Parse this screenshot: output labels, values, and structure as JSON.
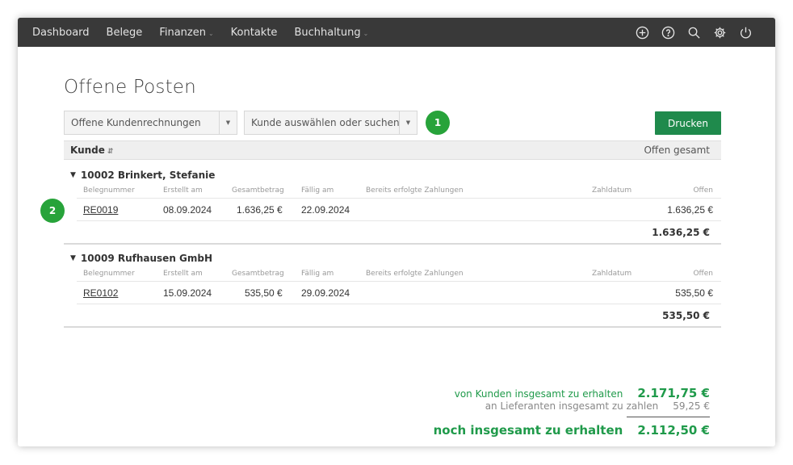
{
  "nav": {
    "items": [
      {
        "label": "Dashboard",
        "dropdown": false
      },
      {
        "label": "Belege",
        "dropdown": false
      },
      {
        "label": "Finanzen",
        "dropdown": true
      },
      {
        "label": "Kontakte",
        "dropdown": false
      },
      {
        "label": "Buchhaltung",
        "dropdown": true
      }
    ],
    "icons": [
      "plus-circle-icon",
      "help-circle-icon",
      "search-icon",
      "gear-icon",
      "power-icon"
    ]
  },
  "page": {
    "title": "Offene Posten",
    "filter_type": "Offene Kundenrechnungen",
    "customer_placeholder": "Kunde auswählen oder suchen",
    "badge_1": "1",
    "badge_2": "2",
    "print_label": "Drucken"
  },
  "table": {
    "col_customer": "Kunde",
    "col_open_total": "Offen gesamt",
    "sub_headers": {
      "belegnummer": "Belegnummer",
      "erstellt": "Erstellt am",
      "gesamtbetrag": "Gesamtbetrag",
      "faellig": "Fällig am",
      "zahlungen": "Bereits erfolgte Zahlungen",
      "zahldatum": "Zahldatum",
      "offen": "Offen"
    },
    "groups": [
      {
        "name": "10002 Brinkert, Stefanie",
        "rows": [
          {
            "beleg": "RE0019",
            "erstellt": "08.09.2024",
            "gesamt": "1.636,25 €",
            "faellig": "22.09.2024",
            "offen": "1.636,25 €"
          }
        ],
        "total": "1.636,25 €"
      },
      {
        "name": "10009 Rufhausen GmbH",
        "rows": [
          {
            "beleg": "RE0102",
            "erstellt": "15.09.2024",
            "gesamt": "535,50 €",
            "faellig": "29.09.2024",
            "offen": "535,50 €"
          }
        ],
        "total": "535,50 €"
      }
    ]
  },
  "summary": {
    "receive_label": "von Kunden insgesamt zu erhalten",
    "receive_value": "2.171,75 €",
    "pay_label": "an Lieferanten insgesamt zu zahlen",
    "pay_value": "59,25 €",
    "net_label": "noch insgesamt zu erhalten",
    "net_value": "2.112,50 €"
  },
  "colors": {
    "topbar": "#393939",
    "accent_green": "#1f8a4c",
    "badge_green": "#27a33a",
    "summary_green": "#1f9a4a"
  }
}
